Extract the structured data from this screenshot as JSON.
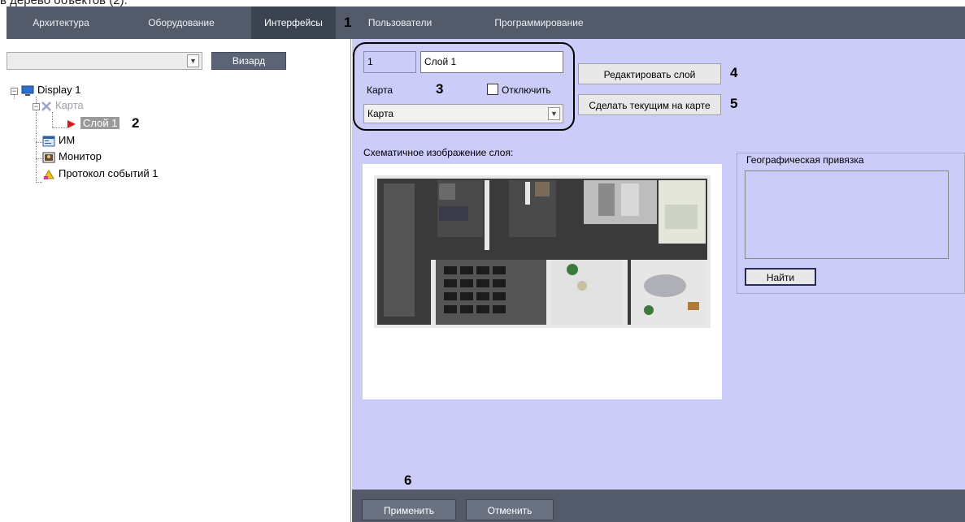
{
  "caption": "в дерево объектов (2).",
  "tabs": [
    "Архитектура",
    "Оборудование",
    "Интерфейсы",
    "Пользователи",
    "Программирование"
  ],
  "active_tab": "Интерфейсы",
  "left": {
    "wizard_button": "Визард",
    "tree": {
      "display": "Display 1",
      "map": "Карта",
      "layer": "Слой 1",
      "im": "ИМ",
      "monitor": "Монитор",
      "protocol": "Протокол событий 1"
    }
  },
  "layer_form": {
    "id_value": "1",
    "name_value": "Слой 1",
    "map_label": "Карта",
    "disable_label": "Отключить",
    "disable_checked": false,
    "map_select_value": "Карта",
    "edit_button": "Редактировать слой",
    "make_current_button": "Сделать текущим на карте",
    "schematic_label": "Схематичное изображение слоя:"
  },
  "geo": {
    "title": "Географическая привязка",
    "find_button": "Найти"
  },
  "footer": {
    "apply_button": "Применить",
    "cancel_button": "Отменить"
  },
  "markers": {
    "m1": "1",
    "m2": "2",
    "m3": "3",
    "m4": "4",
    "m5": "5",
    "m6": "6"
  },
  "colors": {
    "tabbar": "#535b6b",
    "active_tab": "#3b4250",
    "panel_bg": "#ccccf8",
    "layer_arrow": "#e01414"
  }
}
